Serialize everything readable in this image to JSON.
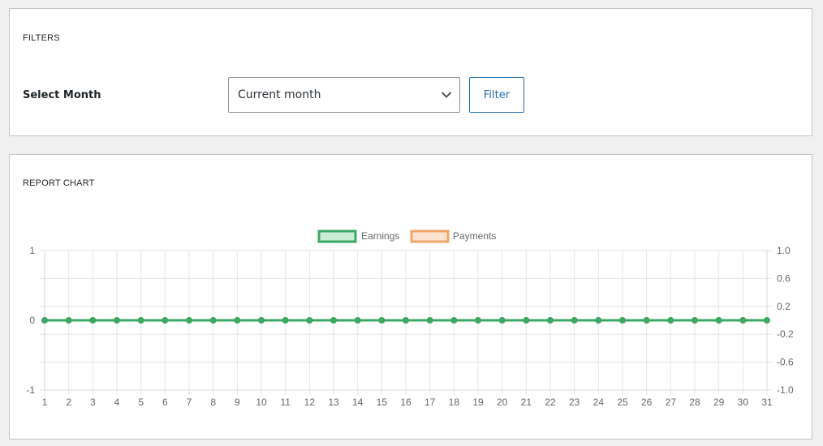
{
  "filters": {
    "title": "FILTERS",
    "month_label": "Select Month",
    "month_select": {
      "selected": "Current month"
    },
    "filter_button": "Filter"
  },
  "report": {
    "title": "REPORT CHART"
  },
  "chart_data": {
    "type": "line",
    "x": [
      1,
      2,
      3,
      4,
      5,
      6,
      7,
      8,
      9,
      10,
      11,
      12,
      13,
      14,
      15,
      16,
      17,
      18,
      19,
      20,
      21,
      22,
      23,
      24,
      25,
      26,
      27,
      28,
      29,
      30,
      31
    ],
    "series": [
      {
        "name": "Earnings",
        "color": "#3da866",
        "fill": "#c8ecd4",
        "values": [
          0,
          0,
          0,
          0,
          0,
          0,
          0,
          0,
          0,
          0,
          0,
          0,
          0,
          0,
          0,
          0,
          0,
          0,
          0,
          0,
          0,
          0,
          0,
          0,
          0,
          0,
          0,
          0,
          0,
          0,
          0
        ]
      },
      {
        "name": "Payments",
        "color": "#f0a56b",
        "fill": "#fde3cf",
        "values": [
          0,
          0,
          0,
          0,
          0,
          0,
          0,
          0,
          0,
          0,
          0,
          0,
          0,
          0,
          0,
          0,
          0,
          0,
          0,
          0,
          0,
          0,
          0,
          0,
          0,
          0,
          0,
          0,
          0,
          0,
          0
        ]
      }
    ],
    "y_left": {
      "ylim": [
        -1,
        1
      ],
      "ticks": [
        "1",
        "0",
        "-1"
      ]
    },
    "y_right": {
      "ylim": [
        -1,
        1
      ],
      "ticks": [
        "1.0",
        "0.6",
        "0.2",
        "-0.2",
        "-0.6",
        "-1.0"
      ]
    },
    "legend_position": "top-center",
    "grid": true
  }
}
